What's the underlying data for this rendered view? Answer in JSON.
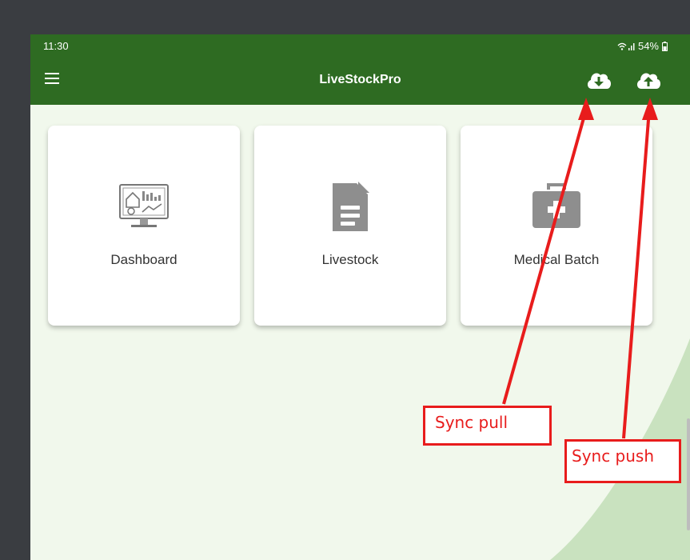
{
  "statusbar": {
    "time": "11:30",
    "battery": "54%"
  },
  "appbar": {
    "title": "LiveStockPro",
    "menu_icon": "hamburger-menu-icon",
    "sync_pull_icon": "cloud-download-icon",
    "sync_push_icon": "cloud-upload-icon"
  },
  "cards": [
    {
      "label": "Dashboard",
      "icon": "dashboard-monitor-icon"
    },
    {
      "label": "Livestock",
      "icon": "document-icon"
    },
    {
      "label": "Medical Batch",
      "icon": "medical-kit-icon"
    }
  ],
  "annotations": {
    "sync_pull": "Sync pull",
    "sync_push": "Sync push"
  },
  "colors": {
    "primary": "#2e6b22",
    "background": "#f1f8ec",
    "annotation": "#e81c1c"
  }
}
